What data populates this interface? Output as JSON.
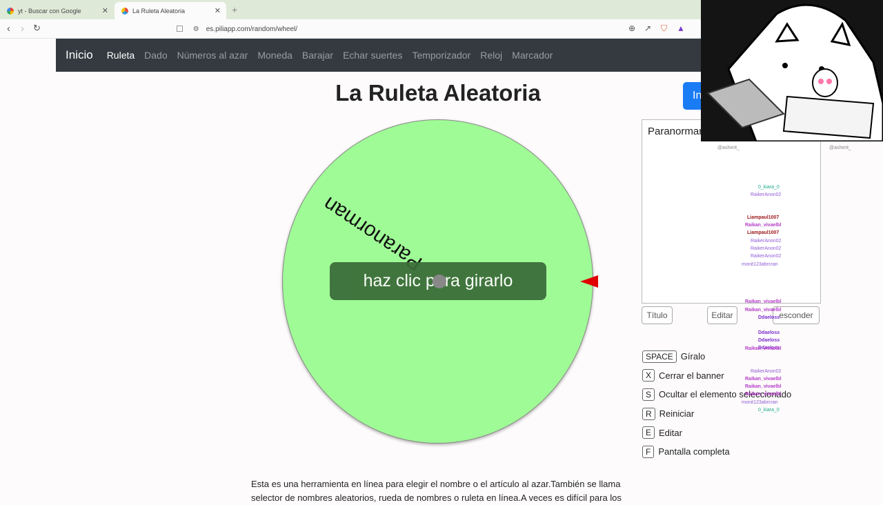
{
  "browser": {
    "tabs": [
      {
        "label": "yt - Buscar con Google"
      },
      {
        "label": "La Ruleta Aleatoria"
      }
    ],
    "url": "es.piliapp.com/random/wheel/"
  },
  "navbar": {
    "brand": "Inicio",
    "links": [
      "Ruleta",
      "Dado",
      "Números al azar",
      "Moneda",
      "Barajar",
      "Echar suertes",
      "Temporizador",
      "Reloj",
      "Marcador"
    ]
  },
  "page": {
    "title": "La Ruleta Aleatoria",
    "wheel_entry": "Paranorman",
    "spin_label": "haz clic para girarlo",
    "right_button_label": "In",
    "entries_text": "Paranorman",
    "buttons": {
      "titulo": "Título",
      "editar": "Editar",
      "esconder": "esconder"
    },
    "shortcuts": [
      {
        "key": "SPACE",
        "label": "Gíralo"
      },
      {
        "key": "X",
        "label": "Cerrar el banner"
      },
      {
        "key": "S",
        "label": "Ocultar el elemento seleccionado"
      },
      {
        "key": "R",
        "label": "Reiniciar"
      },
      {
        "key": "E",
        "label": "Editar"
      },
      {
        "key": "F",
        "label": "Pantalla completa"
      }
    ],
    "description": "Esta es una herramienta en línea para elegir el nombre o el artículo al azar.También se llama selector de nombres aleatorios, rueda de nombres o ruleta en línea.A veces es difícil para los"
  },
  "chat": {
    "handle": "@asherit_",
    "users": [
      "0_kiara_0",
      "RaikerAnon02",
      "Liampaul1007",
      "Raikan_vivaelbl",
      "Liampaul1007",
      "RaikerAnon02",
      "RaikerAnon02",
      "RaikerAnon02",
      "monit123abrcran",
      "Raikan_vivaelbl",
      "Raikan_vivaelbl",
      "Ddaeloss",
      "Ddaeloss",
      "Ddaeloss",
      "Ddaeloss",
      "Raikan_vivaelbl",
      "RaikerAnon02",
      "Raikan_vivaelbl",
      "Raikan_vivaelbl",
      "Raikan_vivaelbl",
      "monit123abrcran",
      "0_kiara_0"
    ]
  },
  "colors": {
    "wheel": "#9ffb96",
    "navbar": "#343a40",
    "pointer": "#e00000",
    "spin_button": "#3a6b38",
    "accent_blue": "#1a7cf5"
  }
}
